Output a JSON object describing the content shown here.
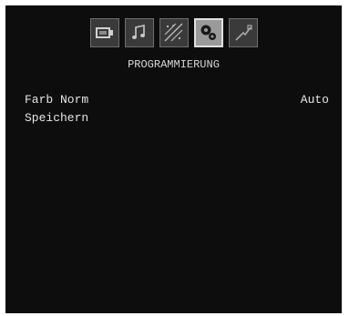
{
  "menu": {
    "title": "PROGRAMMIERUNG",
    "tabs": [
      {
        "icon": "picture-icon",
        "active": false
      },
      {
        "icon": "sound-icon",
        "active": false
      },
      {
        "icon": "features-icon",
        "active": false
      },
      {
        "icon": "setup-icon",
        "active": true
      },
      {
        "icon": "source-icon",
        "active": false
      }
    ],
    "items": [
      {
        "label": "Farb Norm",
        "value": "Auto"
      },
      {
        "label": "Speichern",
        "value": ""
      }
    ]
  },
  "colors": {
    "background": "#0d0d0d",
    "text": "#e6e6e6",
    "active_tab": "#9a9a9a"
  }
}
